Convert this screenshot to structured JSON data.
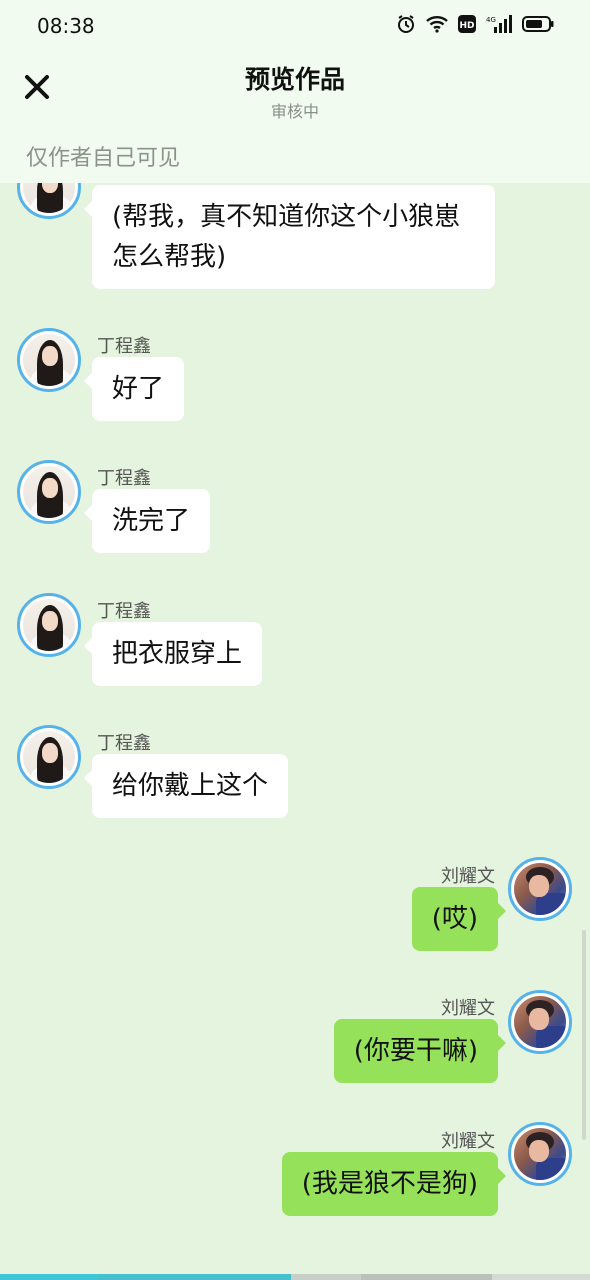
{
  "status_bar": {
    "time": "08:38",
    "icons": [
      "alarm-icon",
      "wifi-icon",
      "hd-icon",
      "signal-4g-icon",
      "battery-icon"
    ]
  },
  "header": {
    "title": "预览作品",
    "subtitle": "审核中",
    "notice": "仅作者自己可见"
  },
  "messages": [
    {
      "side": "left",
      "sender": "",
      "text": "(帮我，真不知道你这个小狼崽怎么帮我)"
    },
    {
      "side": "left",
      "sender": "丁程鑫",
      "text": "好了"
    },
    {
      "side": "left",
      "sender": "丁程鑫",
      "text": "洗完了"
    },
    {
      "side": "left",
      "sender": "丁程鑫",
      "text": "把衣服穿上"
    },
    {
      "side": "left",
      "sender": "丁程鑫",
      "text": "给你戴上这个"
    },
    {
      "side": "right",
      "sender": "刘耀文",
      "text": "(哎)"
    },
    {
      "side": "right",
      "sender": "刘耀文",
      "text": "(你要干嘛)"
    },
    {
      "side": "right",
      "sender": "刘耀文",
      "text": "(我是狼不是狗)"
    }
  ],
  "colors": {
    "background": "#e5f4de",
    "header_bg": "#f1fbf0",
    "left_bubble": "#ffffff",
    "right_bubble": "#95e25a",
    "avatar_border": "#55b2ea"
  }
}
